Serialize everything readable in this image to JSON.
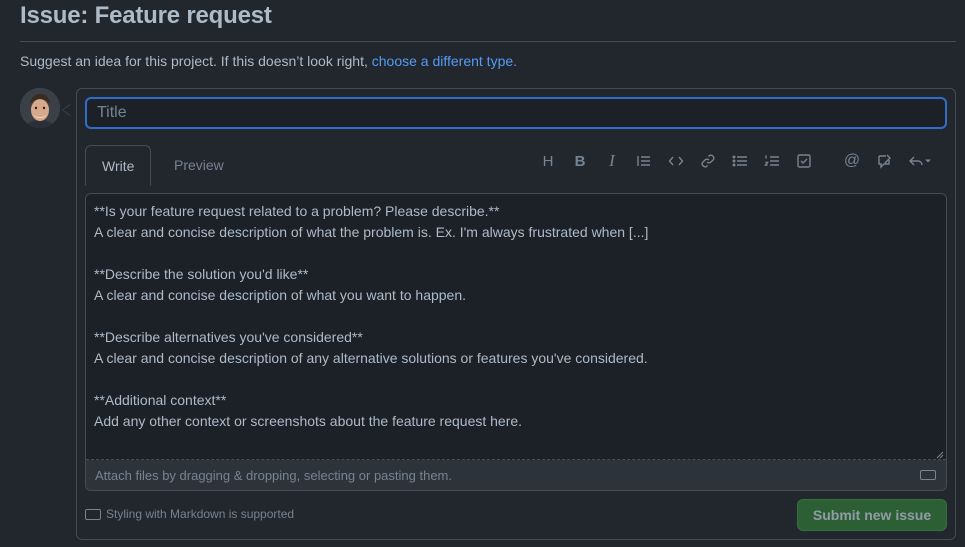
{
  "page": {
    "title": "Issue: Feature request",
    "subtitle_text": "Suggest an idea for this project. If this doesn’t look right, ",
    "subtitle_link": "choose a different type."
  },
  "form": {
    "title_placeholder": "Title",
    "tabs": [
      {
        "label": "Write",
        "active": true
      },
      {
        "label": "Preview",
        "active": false
      }
    ],
    "toolbar": {
      "icons": [
        "heading-icon",
        "bold-icon",
        "italic-icon",
        "quote-icon",
        "code-icon",
        "link-icon",
        "bulleted-list-icon",
        "numbered-list-icon",
        "task-list-icon",
        "mention-icon",
        "reference-icon",
        "reply-icon"
      ],
      "heading_glyph": "H",
      "bold_glyph": "B",
      "italic_glyph": "I",
      "mention_glyph": "@"
    },
    "body": "**Is your feature request related to a problem? Please describe.**\nA clear and concise description of what the problem is. Ex. I'm always frustrated when [...]\n\n**Describe the solution you'd like**\nA clear and concise description of what you want to happen.\n\n**Describe alternatives you've considered**\nA clear and concise description of any alternative solutions or features you've considered.\n\n**Additional context**\nAdd any other context or screenshots about the feature request here.",
    "attach_hint": "Attach files by dragging & dropping, selecting or pasting them.",
    "markdown_note": "Styling with Markdown is supported",
    "submit_label": "Submit new issue"
  },
  "colors": {
    "background": "#22272e",
    "accent_link": "#539bf5",
    "focus_border": "#316dca",
    "submit_green": "#347d39"
  }
}
